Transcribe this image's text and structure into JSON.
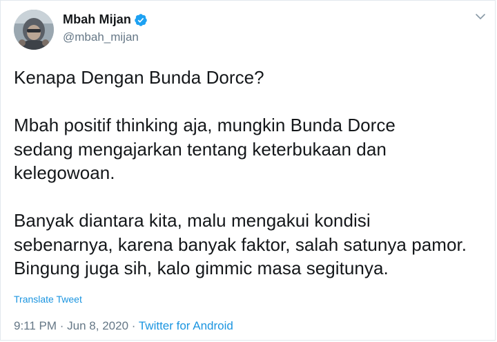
{
  "author": {
    "display_name": "Mbah Mijan",
    "handle": "@mbah_mijan",
    "verified": true
  },
  "tweet": {
    "text": "Kenapa Dengan Bunda Dorce?\n\nMbah positif thinking aja, mungkin Bunda Dorce\nsedang mengajarkan tentang keterbukaan dan\nkelegowoan.\n\nBanyak diantara kita, malu mengakui kondisi\nsebenarnya, karena banyak faktor, salah satunya pamor.\nBingung juga sih, kalo gimmic masa segitunya.",
    "translate_label": "Translate Tweet"
  },
  "meta": {
    "time": "9:11 PM",
    "separator": " · ",
    "date": "Jun 8, 2020",
    "source": "Twitter for Android"
  },
  "colors": {
    "link": "#1b95e0",
    "muted": "#657786",
    "text": "#14171a",
    "verified": "#1da1f2"
  },
  "icons": {
    "verified": "verified-badge-icon",
    "menu": "chevron-down-icon"
  }
}
